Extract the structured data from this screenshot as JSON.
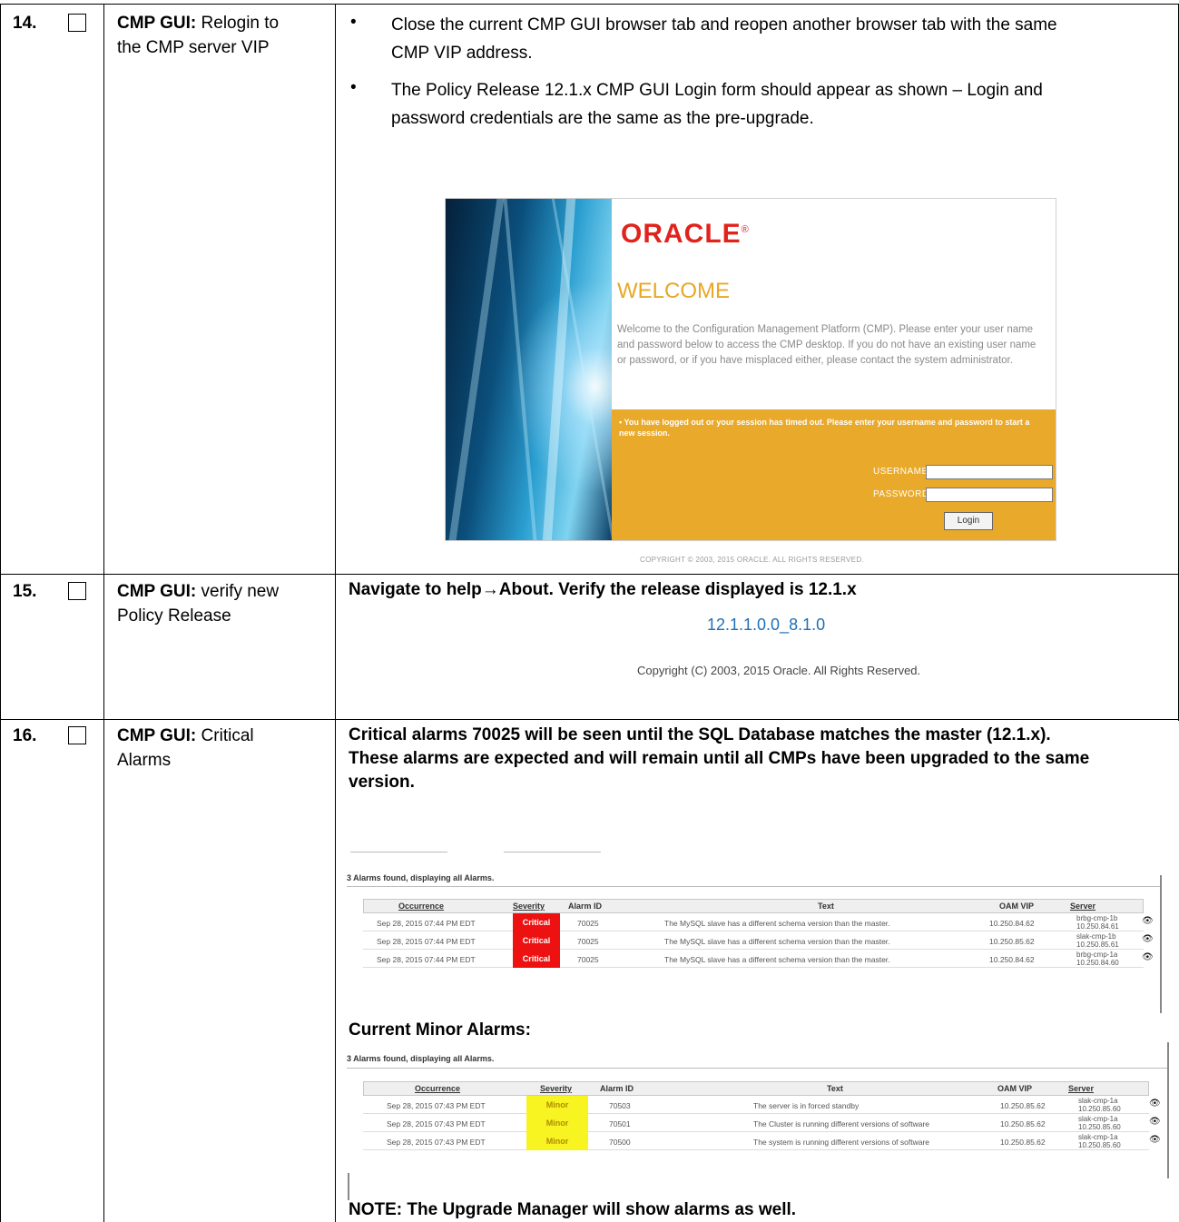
{
  "rows": [
    {
      "num": "14.",
      "step_bold": "CMP GUI:",
      "step_rest_line1": " Relogin to",
      "step_rest_line2": "the CMP server VIP",
      "bullets": [
        {
          "line1": "Close the current CMP GUI browser tab and reopen another browser tab with the same",
          "line2": "CMP VIP address."
        },
        {
          "line1": "The Policy Release 12.1.x CMP GUI Login form should appear as shown – Login and",
          "line2": "password credentials are the same as the pre-upgrade."
        }
      ]
    },
    {
      "num": "15.",
      "step_bold": "CMP GUI:",
      "step_rest_line1": " verify new",
      "step_rest_line2": "Policy Release",
      "instruction_a": "Navigate to help",
      "arrow": "→",
      "instruction_b": "About. Verify the release displayed is 12.1.x"
    },
    {
      "num": "16.",
      "step_bold": "CMP GUI:",
      "step_rest_line1": " Critical",
      "step_rest_line2": "Alarms",
      "instruction_line1": "Critical alarms 70025 will be seen until the SQL Database matches the master (12.1.x).",
      "instruction_line2": "These alarms are expected and will remain until all CMPs have been upgraded to the same",
      "instruction_line3": "version.",
      "minor_heading": "Current Minor Alarms:",
      "note": "NOTE: The Upgrade Manager will show alarms as well."
    }
  ],
  "login": {
    "logo": "ORACLE",
    "logo_mark": "®",
    "welcome": "WELCOME",
    "welcome_text": "Welcome to the Configuration Management Platform (CMP). Please enter your user name and password below to access the CMP desktop. If you do not have an existing user name or password, or if you have misplaced either, please contact the system administrator.",
    "session_msg": "• You have logged out or your session has timed out. Please enter your username and password to start a new session.",
    "username_label": "USERNAME",
    "password_label": "PASSWORD",
    "login_button": "Login",
    "copyright": "COPYRIGHT © 2003, 2015 ORACLE. ALL RIGHTS RESERVED."
  },
  "about": {
    "version": "12.1.1.0.0_8.1.0",
    "copyright": "Copyright (C) 2003, 2015 Oracle. All Rights Reserved."
  },
  "critical_alarms": {
    "found_text": "3 Alarms found, displaying all Alarms.",
    "headers": [
      "Occurrence",
      "Severity",
      "Alarm ID",
      "Text",
      "OAM VIP",
      "Server"
    ],
    "rows": [
      {
        "occurrence": "Sep 28, 2015 07:44 PM EDT",
        "severity": "Critical",
        "alarm_id": "70025",
        "text": "The MySQL slave has a different schema version than the master.",
        "oam_vip": "10.250.84.62",
        "server_name": "brbg-cmp-1b",
        "server_ip": "10.250.84.61"
      },
      {
        "occurrence": "Sep 28, 2015 07:44 PM EDT",
        "severity": "Critical",
        "alarm_id": "70025",
        "text": "The MySQL slave has a different schema version than the master.",
        "oam_vip": "10.250.85.62",
        "server_name": "slak-cmp-1b",
        "server_ip": "10.250.85.61"
      },
      {
        "occurrence": "Sep 28, 2015 07:44 PM EDT",
        "severity": "Critical",
        "alarm_id": "70025",
        "text": "The MySQL slave has a different schema version than the master.",
        "oam_vip": "10.250.84.62",
        "server_name": "brbg-cmp-1a",
        "server_ip": "10.250.84.60"
      }
    ],
    "severity_color": "#ee1111"
  },
  "minor_alarms": {
    "found_text": "3 Alarms found, displaying all Alarms.",
    "headers": [
      "Occurrence",
      "Severity",
      "Alarm ID",
      "Text",
      "OAM VIP",
      "Server"
    ],
    "rows": [
      {
        "occurrence": "Sep 28, 2015 07:43 PM EDT",
        "severity": "Minor",
        "alarm_id": "70503",
        "text": "The server is in forced standby",
        "oam_vip": "10.250.85.62",
        "server_name": "slak-cmp-1a",
        "server_ip": "10.250.85.60"
      },
      {
        "occurrence": "Sep 28, 2015 07:43 PM EDT",
        "severity": "Minor",
        "alarm_id": "70501",
        "text": "The Cluster is running different versions of software",
        "oam_vip": "10.250.85.62",
        "server_name": "slak-cmp-1a",
        "server_ip": "10.250.85.60"
      },
      {
        "occurrence": "Sep 28, 2015 07:43 PM EDT",
        "severity": "Minor",
        "alarm_id": "70500",
        "text": "The system is running different versions of software",
        "oam_vip": "10.250.85.62",
        "server_name": "slak-cmp-1a",
        "server_ip": "10.250.85.60"
      }
    ],
    "severity_color": "#f7f421"
  },
  "icons": {
    "binoculars": "binoculars-icon",
    "bullet": "•"
  }
}
